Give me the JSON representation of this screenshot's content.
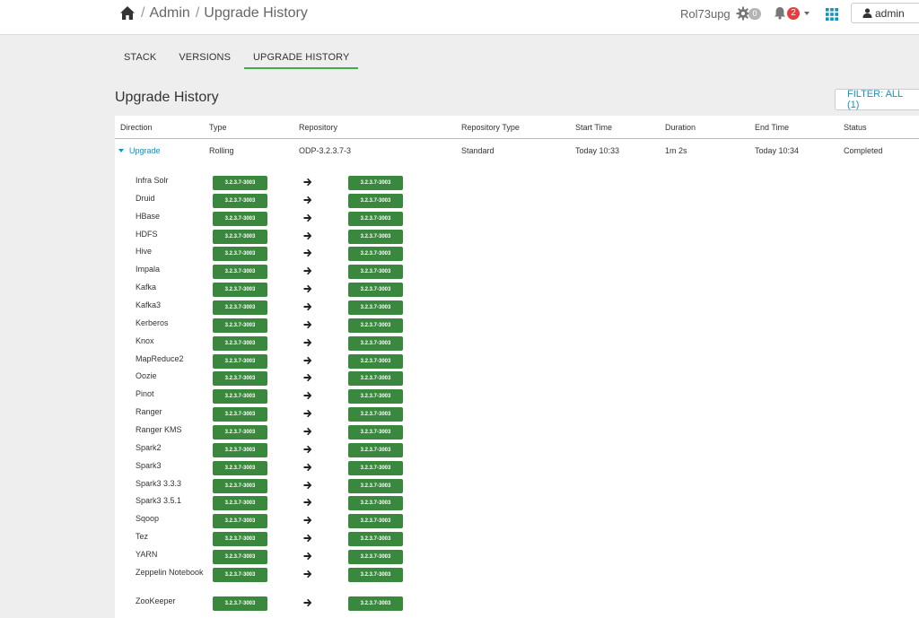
{
  "header": {
    "breadcrumb": [
      {
        "label": "Admin"
      },
      {
        "label": "Upgrade History"
      }
    ],
    "cluster_name": "Rol73upg",
    "ops_count": "0",
    "alerts_count": "2",
    "user_label": "admin",
    "icons": [
      "home-icon",
      "gear-icon",
      "bell-icon",
      "apps-icon",
      "user-icon"
    ]
  },
  "tabs": [
    {
      "label": "STACK",
      "active": false
    },
    {
      "label": "VERSIONS",
      "active": false
    },
    {
      "label": "UPGRADE HISTORY",
      "active": true
    }
  ],
  "page": {
    "title": "Upgrade History",
    "filter_label": "FILTER: ALL (1)"
  },
  "table": {
    "columns": [
      "Direction",
      "Type",
      "Repository",
      "Repository Type",
      "Start Time",
      "Duration",
      "End Time",
      "Status"
    ],
    "row": {
      "direction": "Upgrade",
      "type": "Rolling",
      "repository": "ODP-3.2.3.7-3",
      "repository_type": "Standard",
      "start_time": "Today 10:33",
      "duration": "1m 2s",
      "end_time": "Today 10:34",
      "status": "Completed"
    },
    "services": [
      {
        "name": "Infra Solr",
        "from": "3.2.3.7-3003",
        "to": "3.2.3.7-3003"
      },
      {
        "name": "Druid",
        "from": "3.2.3.7-3003",
        "to": "3.2.3.7-3003"
      },
      {
        "name": "HBase",
        "from": "3.2.3.7-3003",
        "to": "3.2.3.7-3003"
      },
      {
        "name": "HDFS",
        "from": "3.2.3.7-3003",
        "to": "3.2.3.7-3003"
      },
      {
        "name": "Hive",
        "from": "3.2.3.7-3003",
        "to": "3.2.3.7-3003"
      },
      {
        "name": "Impala",
        "from": "3.2.3.7-3003",
        "to": "3.2.3.7-3003"
      },
      {
        "name": "Kafka",
        "from": "3.2.3.7-3003",
        "to": "3.2.3.7-3003"
      },
      {
        "name": "Kafka3",
        "from": "3.2.3.7-3003",
        "to": "3.2.3.7-3003"
      },
      {
        "name": "Kerberos",
        "from": "3.2.3.7-3003",
        "to": "3.2.3.7-3003"
      },
      {
        "name": "Knox",
        "from": "3.2.3.7-3003",
        "to": "3.2.3.7-3003"
      },
      {
        "name": "MapReduce2",
        "from": "3.2.3.7-3003",
        "to": "3.2.3.7-3003"
      },
      {
        "name": "Oozie",
        "from": "3.2.3.7-3003",
        "to": "3.2.3.7-3003"
      },
      {
        "name": "Pinot",
        "from": "3.2.3.7-3003",
        "to": "3.2.3.7-3003"
      },
      {
        "name": "Ranger",
        "from": "3.2.3.7-3003",
        "to": "3.2.3.7-3003"
      },
      {
        "name": "Ranger KMS",
        "from": "3.2.3.7-3003",
        "to": "3.2.3.7-3003"
      },
      {
        "name": "Spark2",
        "from": "3.2.3.7-3003",
        "to": "3.2.3.7-3003"
      },
      {
        "name": "Spark3",
        "from": "3.2.3.7-3003",
        "to": "3.2.3.7-3003"
      },
      {
        "name": "Spark3 3.3.3",
        "from": "3.2.3.7-3003",
        "to": "3.2.3.7-3003"
      },
      {
        "name": "Spark3 3.5.1",
        "from": "3.2.3.7-3003",
        "to": "3.2.3.7-3003"
      },
      {
        "name": "Sqoop",
        "from": "3.2.3.7-3003",
        "to": "3.2.3.7-3003"
      },
      {
        "name": "Tez",
        "from": "3.2.3.7-3003",
        "to": "3.2.3.7-3003"
      },
      {
        "name": "YARN",
        "from": "3.2.3.7-3003",
        "to": "3.2.3.7-3003"
      },
      {
        "name": "Zeppelin Notebook",
        "from": "3.2.3.7-3003",
        "to": "3.2.3.7-3003"
      },
      {
        "name": "ZooKeeper",
        "from": "3.2.3.7-3003",
        "to": "3.2.3.7-3003"
      }
    ]
  },
  "colors": {
    "accent": "#1491c1",
    "active_tab_underline": "#3fae49",
    "version_badge": "#3a873e",
    "alert_badge": "#e53d3d"
  }
}
